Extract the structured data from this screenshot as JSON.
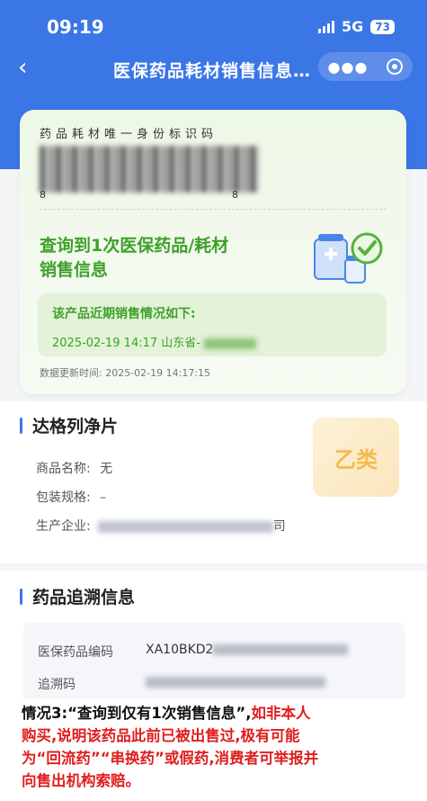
{
  "status_bar": {
    "time": "09:19",
    "network": "5G",
    "battery": "73"
  },
  "navbar": {
    "back": "‹",
    "title": "医保药品耗材销售信息…"
  },
  "result_card": {
    "code_title": "药品耗材唯一身份标识码",
    "barcode_left": "8",
    "barcode_right": "8",
    "found_line1": "查询到1次医保药品/耗材",
    "found_line2": "销售信息",
    "recent_title": "该产品近期销售情况如下:",
    "recent_record": "2025-02-19 14:17  山东省-",
    "update_time": "数据更新时间: 2025-02-19 14:17:15"
  },
  "product": {
    "name": "达格列净片",
    "type_badge": "乙类",
    "fields": [
      {
        "label": "商品名称:",
        "value": "无"
      },
      {
        "label": "包装规格:",
        "value": "–"
      },
      {
        "label": "生产企业:",
        "value": "",
        "suffix": "司"
      }
    ]
  },
  "trace": {
    "title": "药品追溯信息",
    "rows": [
      {
        "label": "医保药品编码",
        "value": "XA10BKD2"
      },
      {
        "label": "追溯码",
        "value": ""
      }
    ]
  },
  "note": {
    "line1_black": "情况3:“查询到仅有1次销售信息”,",
    "line1_red": "如非本人",
    "line2": "购买,说明该药品此前已被出售过,极有可能",
    "line3": "为“回流药”“串换药”或假药,消费者可举报并",
    "line4": "向售出机构索赔。"
  },
  "colors": {
    "brand_blue": "#3b76e6",
    "success_green": "#3ea12a",
    "warning_red": "#e01e1e",
    "badge_orange": "#f6b94e"
  }
}
